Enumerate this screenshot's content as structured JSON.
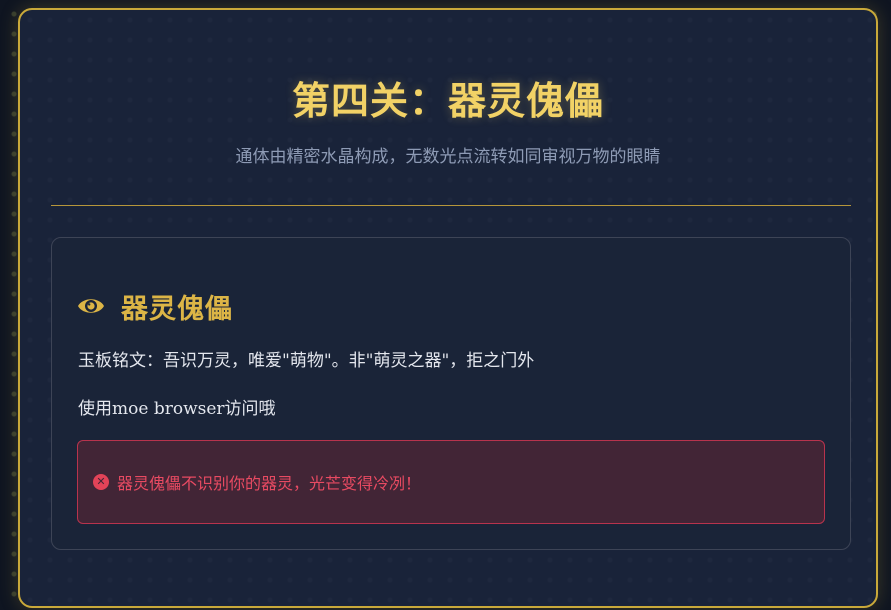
{
  "header": {
    "title": "第四关：器灵傀儡",
    "subtitle": "通体由精密水晶构成，无数光点流转如同审视万物的眼睛"
  },
  "card": {
    "icon": "eye-icon",
    "title": "器灵傀儡",
    "inscription": "玉板铭文：吾识万灵，唯爱\"萌物\"。非\"萌灵之器\"，拒之门外",
    "hint": "使用moe browser访问哦"
  },
  "error": {
    "icon": "error-x-icon",
    "message": "器灵傀儡不识别你的器灵，光芒变得冷冽！"
  },
  "colors": {
    "accent_gold": "#f2d266",
    "border_gold": "#c9a93a",
    "panel_bg": "#192339",
    "error_red": "#e84a62",
    "error_bg": "#422536"
  }
}
